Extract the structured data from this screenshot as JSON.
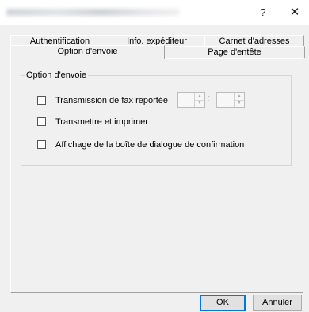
{
  "window": {
    "title_obscured": true,
    "help_glyph": "?",
    "close_glyph": "✕"
  },
  "tabs": {
    "back_row": [
      "Authentification",
      "Info. expéditeur",
      "Carnet d'adresses"
    ],
    "front_row": [
      "Option d'envoie",
      "Page d'entête"
    ],
    "selected": "Option d'envoie"
  },
  "group": {
    "legend": "Option d'envoie",
    "options": [
      {
        "label": "Transmission de fax reportée",
        "checked": false
      },
      {
        "label": "Transmettre et imprimer",
        "checked": false
      },
      {
        "label": "Affichage de la boîte de dialogue de confirmation",
        "checked": false
      }
    ],
    "time_separator": ":"
  },
  "buttons": {
    "ok": "OK",
    "cancel": "Annuler"
  }
}
